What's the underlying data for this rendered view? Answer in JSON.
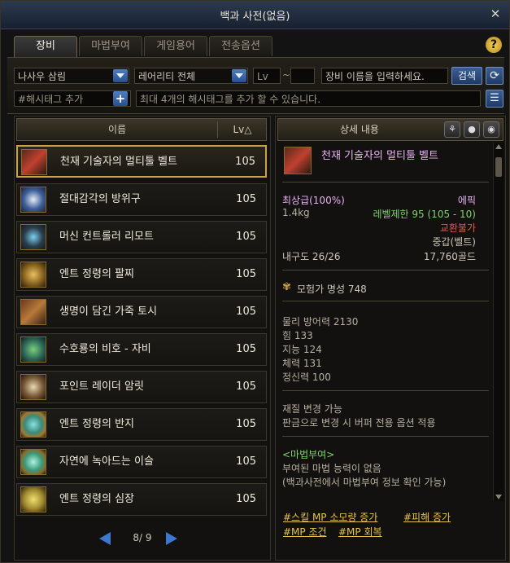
{
  "window": {
    "title": "백과 사전(없음)",
    "close_label": "✕"
  },
  "tabs": [
    {
      "label": "장비",
      "active": true
    },
    {
      "label": "마법부여",
      "active": false
    },
    {
      "label": "게임용어",
      "active": false
    },
    {
      "label": "전송옵션",
      "active": false
    }
  ],
  "help_label": "?",
  "filters": {
    "class_select": "나사우 삼림",
    "rarity_select": "레어리티 전체",
    "lv_from_placeholder": "Lv",
    "tilde": "~",
    "name_placeholder": "장비 이름을 입력하세요.",
    "search_label": "검색",
    "hashtag_placeholder": "#해시태그 추가",
    "hashtag_hint": "최대 4개의 해시태그를 추가 할 수 있습니다."
  },
  "list": {
    "header_name": "이름",
    "header_lv": "Lv△",
    "items": [
      {
        "name": "천재 기술자의 멀티툴 벨트",
        "lv": "105",
        "icon": "belt-icon",
        "selected": true
      },
      {
        "name": "절대감각의 방위구",
        "lv": "105",
        "icon": "compass-icon",
        "selected": false
      },
      {
        "name": "머신 컨트롤러 리모트",
        "lv": "105",
        "icon": "remote-icon",
        "selected": false
      },
      {
        "name": "엔트 정령의 팔찌",
        "lv": "105",
        "icon": "bracelet-icon",
        "selected": false
      },
      {
        "name": "생명이 담긴 가죽 토시",
        "lv": "105",
        "icon": "leather-sleeve-icon",
        "selected": false
      },
      {
        "name": "수호룡의 비호 - 자비",
        "lv": "105",
        "icon": "dragon-guard-icon",
        "selected": false
      },
      {
        "name": "포인트 레이더 암릿",
        "lv": "105",
        "icon": "armlet-icon",
        "selected": false
      },
      {
        "name": "엔트 정령의 반지",
        "lv": "105",
        "icon": "ring-icon",
        "selected": false
      },
      {
        "name": "자연에 녹아드는 이슬",
        "lv": "105",
        "icon": "dew-icon",
        "selected": false
      },
      {
        "name": "엔트 정령의 심장",
        "lv": "105",
        "icon": "heart-stone-icon",
        "selected": false
      }
    ],
    "pager": "8/ 9"
  },
  "detail": {
    "header": "상세 내용",
    "title": "천재 기술자의 멀티툴 벨트",
    "grade": "최상급(100%)",
    "rarity": "에픽",
    "weight": "1.4kg",
    "level_limit": "레벨제한 95 (105 - 10)",
    "trade": "교환불가",
    "type": "중갑(벨트)",
    "durability": "내구도 26/26",
    "price": "17,760골드",
    "fame": "모험가 명성 748",
    "stats": [
      "물리 방어력 2130",
      "힘 133",
      "지능 124",
      "체력 131",
      "정신력 100"
    ],
    "material_1": "재질 변경 가능",
    "material_2": "판금으로 변경 시 버퍼 전용 옵션 적용",
    "enchant_header": "<마법부여>",
    "enchant_1": "부여된 마법 능력이 없음",
    "enchant_2": "(백과사전에서 마법부여 정보 확인 가능)",
    "tags": [
      "#스킬 MP 소모량 증가",
      "#피해 증가",
      "#MP 조건",
      "#MP 회복"
    ]
  },
  "colors": {
    "epic": "#e9b2f3",
    "accent_gold": "#c9a24a",
    "tag": "#e6c34a",
    "trade_red": "#e05a4a",
    "green": "#7ed36a"
  }
}
